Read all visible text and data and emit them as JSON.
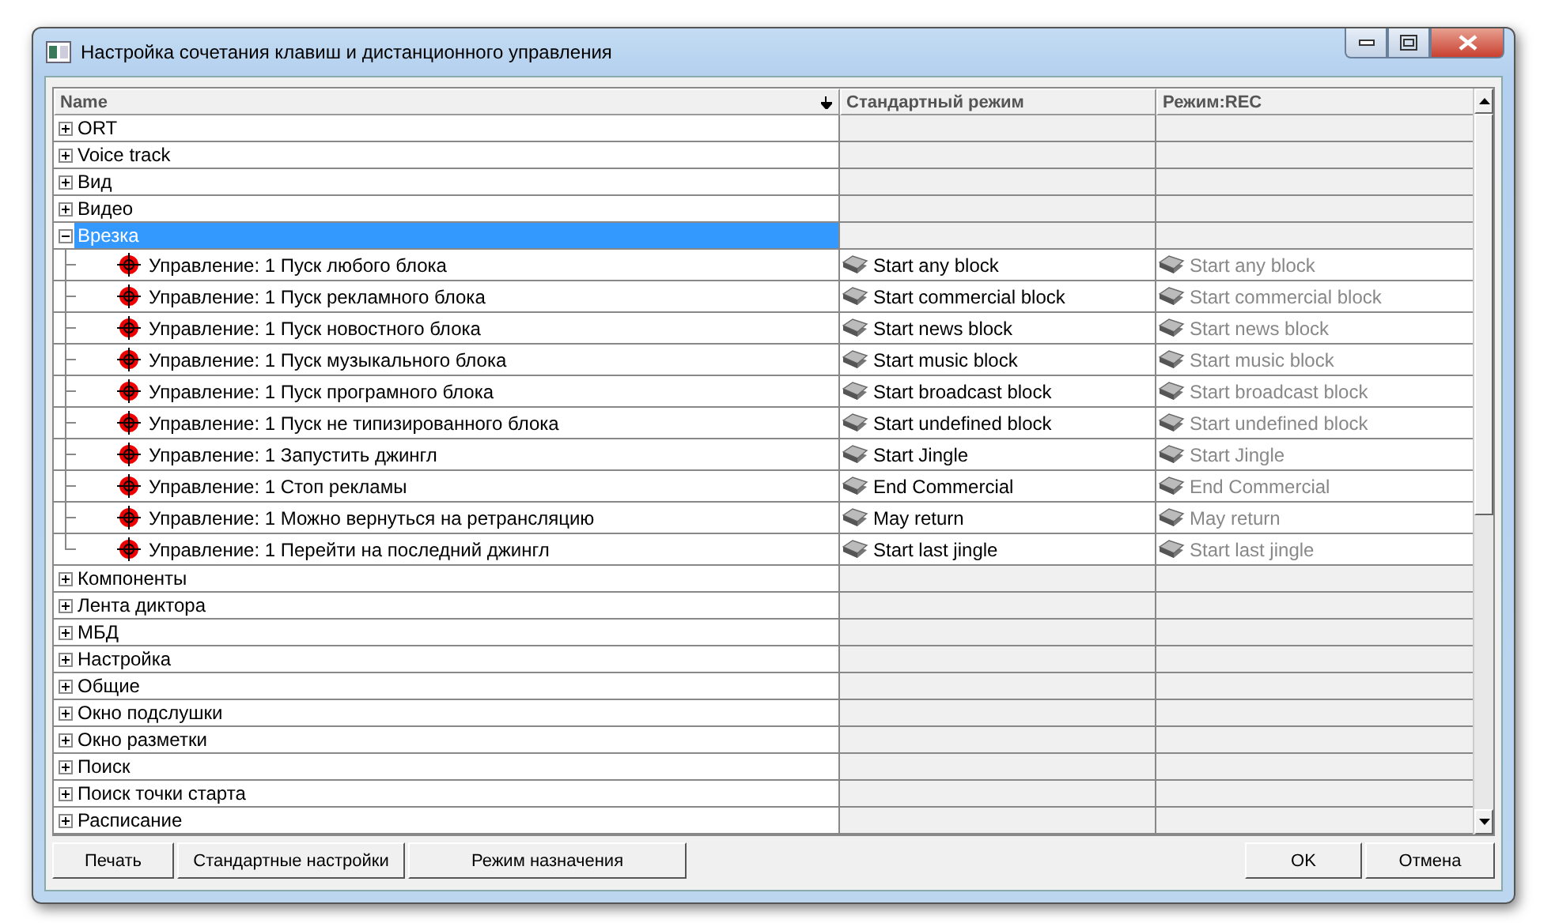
{
  "window": {
    "title": "Настройка сочетания клавиш и дистанционного управления"
  },
  "columns": [
    {
      "label": "Name",
      "sorted": true
    },
    {
      "label": "Стандартный режим",
      "sorted": false
    },
    {
      "label": "Режим:REC",
      "sorted": false
    }
  ],
  "groups": [
    {
      "label": "ORT",
      "expanded": false,
      "selected": false
    },
    {
      "label": "Voice track",
      "expanded": false,
      "selected": false
    },
    {
      "label": "Вид",
      "expanded": false,
      "selected": false
    },
    {
      "label": "Видео",
      "expanded": false,
      "selected": false
    },
    {
      "label": "Врезка",
      "expanded": true,
      "selected": true,
      "children": [
        {
          "label": "Управление: 1 Пуск любого блока",
          "cells": [
            {
              "text": "Start any block",
              "dimmed": false
            },
            {
              "text": "Start any block",
              "dimmed": true
            }
          ]
        },
        {
          "label": "Управление: 1 Пуск рекламного блока",
          "cells": [
            {
              "text": "Start commercial block",
              "dimmed": false
            },
            {
              "text": "Start commercial block",
              "dimmed": true
            }
          ]
        },
        {
          "label": "Управление: 1 Пуск новостного блока",
          "cells": [
            {
              "text": "Start news block",
              "dimmed": false
            },
            {
              "text": "Start news block",
              "dimmed": true
            }
          ]
        },
        {
          "label": "Управление: 1 Пуск музыкального блока",
          "cells": [
            {
              "text": "Start music block",
              "dimmed": false
            },
            {
              "text": "Start music block",
              "dimmed": true
            }
          ]
        },
        {
          "label": "Управление: 1 Пуск програмного блока",
          "cells": [
            {
              "text": "Start broadcast block",
              "dimmed": false
            },
            {
              "text": "Start broadcast block",
              "dimmed": true
            }
          ]
        },
        {
          "label": "Управление: 1 Пуск не типизированного блока",
          "cells": [
            {
              "text": "Start undefined block",
              "dimmed": false
            },
            {
              "text": "Start undefined block",
              "dimmed": true
            }
          ]
        },
        {
          "label": "Управление: 1 Запустить джингл",
          "cells": [
            {
              "text": "Start Jingle",
              "dimmed": false
            },
            {
              "text": "Start Jingle",
              "dimmed": true
            }
          ]
        },
        {
          "label": "Управление: 1 Стоп рекламы",
          "cells": [
            {
              "text": "End Commercial",
              "dimmed": false
            },
            {
              "text": "End Commercial",
              "dimmed": true
            }
          ]
        },
        {
          "label": "Управление: 1 Можно вернуться на ретрансляцию",
          "cells": [
            {
              "text": "May return",
              "dimmed": false
            },
            {
              "text": "May return",
              "dimmed": true
            }
          ]
        },
        {
          "label": "Управление: 1 Перейти на последний джингл",
          "cells": [
            {
              "text": "Start last jingle",
              "dimmed": false
            },
            {
              "text": "Start last jingle",
              "dimmed": true
            }
          ]
        }
      ]
    },
    {
      "label": "Компоненты",
      "expanded": false,
      "selected": false
    },
    {
      "label": "Лента диктора",
      "expanded": false,
      "selected": false
    },
    {
      "label": "МБД",
      "expanded": false,
      "selected": false
    },
    {
      "label": "Настройка",
      "expanded": false,
      "selected": false
    },
    {
      "label": "Общие",
      "expanded": false,
      "selected": false
    },
    {
      "label": "Окно подслушки",
      "expanded": false,
      "selected": false
    },
    {
      "label": "Окно разметки",
      "expanded": false,
      "selected": false
    },
    {
      "label": "Поиск",
      "expanded": false,
      "selected": false
    },
    {
      "label": "Поиск точки старта",
      "expanded": false,
      "selected": false
    },
    {
      "label": "Расписание",
      "expanded": false,
      "selected": false
    }
  ],
  "buttons_left": [
    "Печать",
    "Стандартные настройки",
    "Режим назначения"
  ],
  "buttons_right": [
    "OK",
    "Отмена"
  ]
}
